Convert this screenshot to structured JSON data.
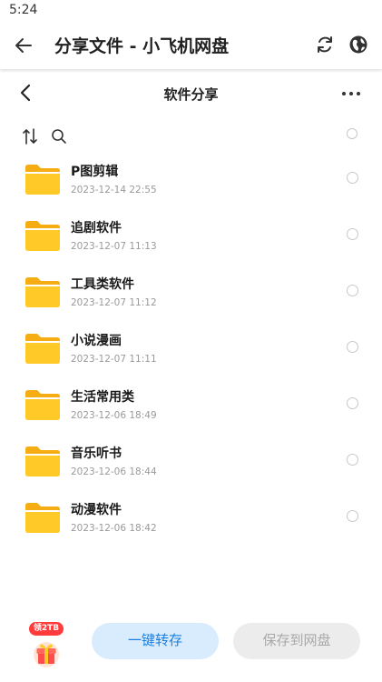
{
  "status_bar": {
    "time": "5:24"
  },
  "app_bar": {
    "title": "分享文件 - 小飞机网盘",
    "icons": [
      "back-arrow-icon",
      "sync-icon",
      "globe-icon"
    ]
  },
  "sub_header": {
    "title": "软件分享",
    "icons": [
      "chevron-left-icon",
      "more-icon"
    ]
  },
  "toolbar": {
    "icons": [
      "sort-icon",
      "search-icon"
    ]
  },
  "files": [
    {
      "name": "P图剪辑",
      "date": "2023-12-14 22:55"
    },
    {
      "name": "追剧软件",
      "date": "2023-12-07 11:13"
    },
    {
      "name": "工具类软件",
      "date": "2023-12-07 11:12"
    },
    {
      "name": "小说漫画",
      "date": "2023-12-07 11:11"
    },
    {
      "name": "生活常用类",
      "date": "2023-12-06 18:49"
    },
    {
      "name": "音乐听书",
      "date": "2023-12-06 18:44"
    },
    {
      "name": "动漫软件",
      "date": "2023-12-06 18:42"
    }
  ],
  "bottom": {
    "gift_badge": "领2TB",
    "save_all_label": "一键转存",
    "save_to_disk_label": "保存到网盘"
  },
  "colors": {
    "folder": "#ffc928",
    "folder_dark": "#f5ad13",
    "accent": "#1b7fe0",
    "accent_bg": "#d8ecfd",
    "badge": "#ff3b3b"
  }
}
